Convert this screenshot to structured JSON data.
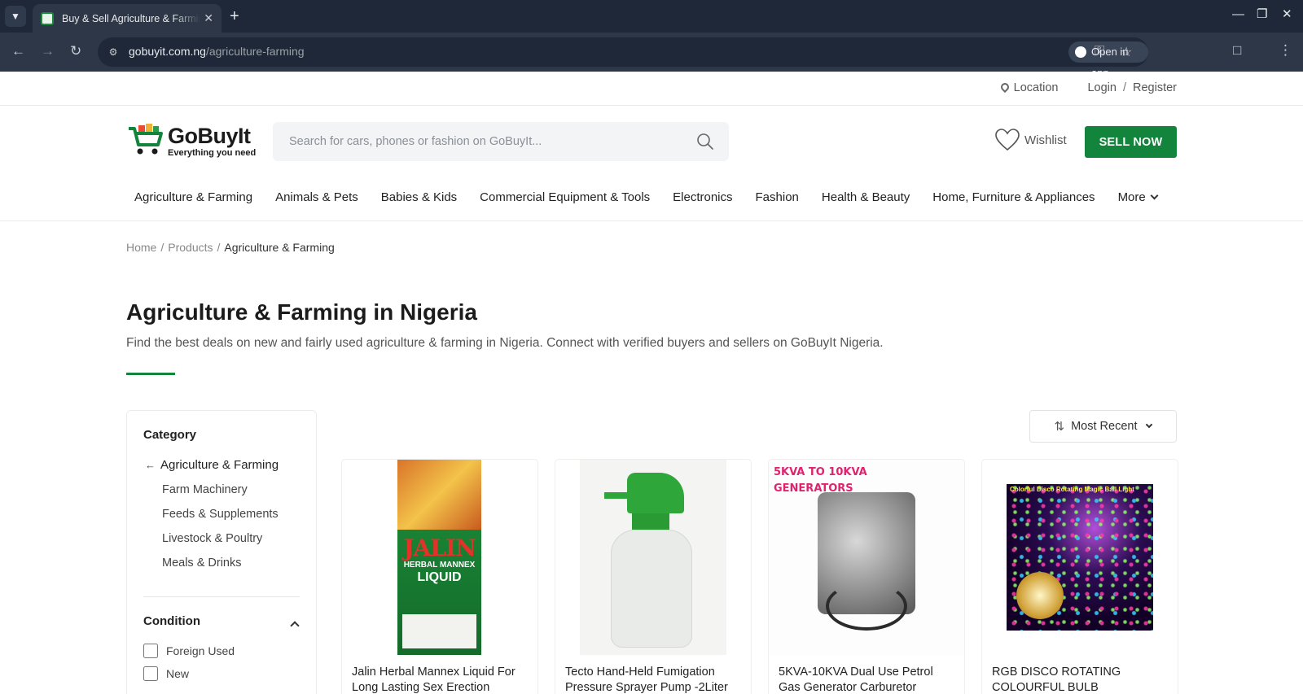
{
  "browser": {
    "tab_title": "Buy & Sell Agriculture & Farming in Nigeria",
    "url_host": "gobuyit.com.ng",
    "url_path": "/agriculture-farming",
    "open_in_app": "Open in app"
  },
  "topbar": {
    "location": "Location",
    "login": "Login",
    "separator": "/",
    "register": "Register"
  },
  "header": {
    "logo_name": "GoBuyIt",
    "logo_tagline": "Everything you need",
    "search_placeholder": "Search for cars, phones or fashion on GoBuyIt...",
    "wishlist": "Wishlist",
    "sell_now": "SELL NOW"
  },
  "categories": [
    "Agriculture & Farming",
    "Animals & Pets",
    "Babies & Kids",
    "Commercial Equipment & Tools",
    "Electronics",
    "Fashion",
    "Health & Beauty",
    "Home, Furniture & Appliances",
    "More"
  ],
  "breadcrumb": {
    "home": "Home",
    "products": "Products",
    "current": "Agriculture & Farming"
  },
  "main": {
    "title": "Agriculture & Farming in Nigeria",
    "description": "Find the best deals on new and fairly used agriculture & farming in Nigeria. Connect with verified buyers and sellers on GoBuyIt Nigeria."
  },
  "sidebar": {
    "category_heading": "Category",
    "active_category": "Agriculture & Farming",
    "subcategories": [
      "Farm Machinery",
      "Feeds & Supplements",
      "Livestock & Poultry",
      "Meals & Drinks"
    ],
    "condition_heading": "Condition",
    "conditions": [
      "Foreign Used",
      "New"
    ]
  },
  "sort": {
    "selected": "Most Recent"
  },
  "products": [
    {
      "title": "Jalin Herbal Mannex Liquid For Long Lasting Sex Erection",
      "image_text": {
        "brand": "JALIN",
        "line1": "HERBAL MANNEX",
        "line2": "LIQUID"
      }
    },
    {
      "title": "Tecto Hand-Held Fumigation Pressure Sprayer Pump -2Liter"
    },
    {
      "title": "5KVA-10KVA Dual Use Petrol Gas Generator Carburetor",
      "image_text": {
        "line1": "5KVA TO 10KVA",
        "line2": "GENERATORS"
      }
    },
    {
      "title": "RGB DISCO ROTATING COLOURFUL BULB",
      "image_text": {
        "line1": "Colorful Disco Rotating Magic Ball Light"
      }
    }
  ],
  "colors": {
    "brand_green": "#13843b",
    "chrome_dark": "#1f2838",
    "chrome_mid": "#2e3748"
  }
}
